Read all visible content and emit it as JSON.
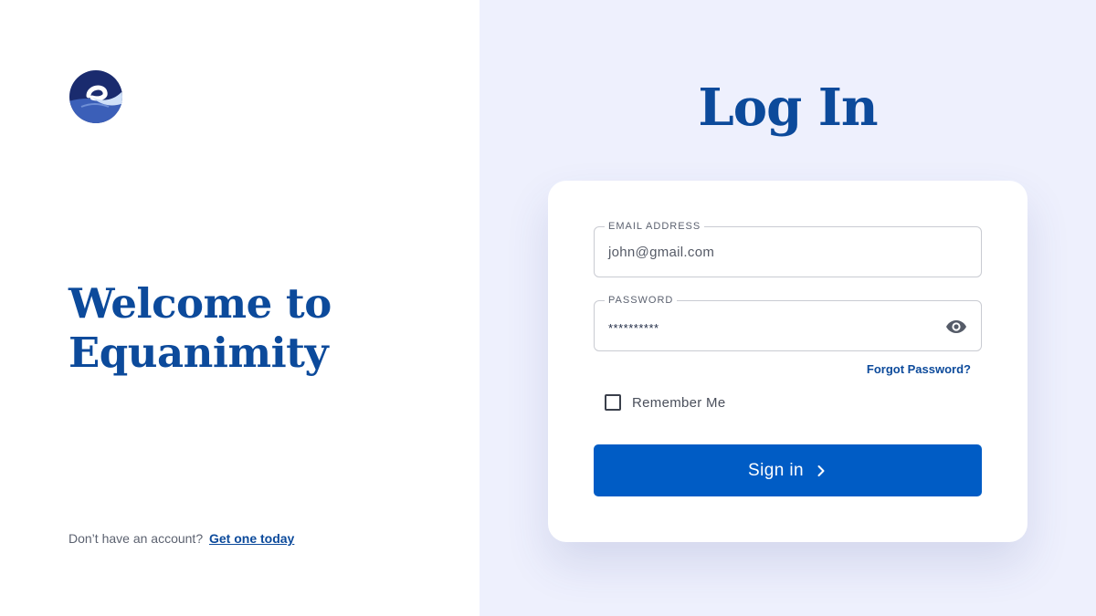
{
  "brand": {
    "logo_icon": "equanimity-logo-icon",
    "welcome_line1": "Welcome to",
    "welcome_line2": "Equanimity"
  },
  "signup": {
    "prompt": "Don’t have an account?",
    "link_label": "Get one today"
  },
  "login": {
    "title": "Log In",
    "email": {
      "label": "EMAIL ADDRESS",
      "value": "john@gmail.com"
    },
    "password": {
      "label": "PASSWORD",
      "value": "**********",
      "toggle_icon": "eye-icon"
    },
    "forgot_label": "Forgot Password?",
    "remember_label": "Remember Me",
    "remember_checked": false,
    "submit_label": "Sign in",
    "submit_icon": "chevron-right-icon"
  },
  "colors": {
    "brand_blue": "#0c4a9b",
    "button_blue": "#005cc5",
    "right_panel_bg": "#eef0fd"
  }
}
